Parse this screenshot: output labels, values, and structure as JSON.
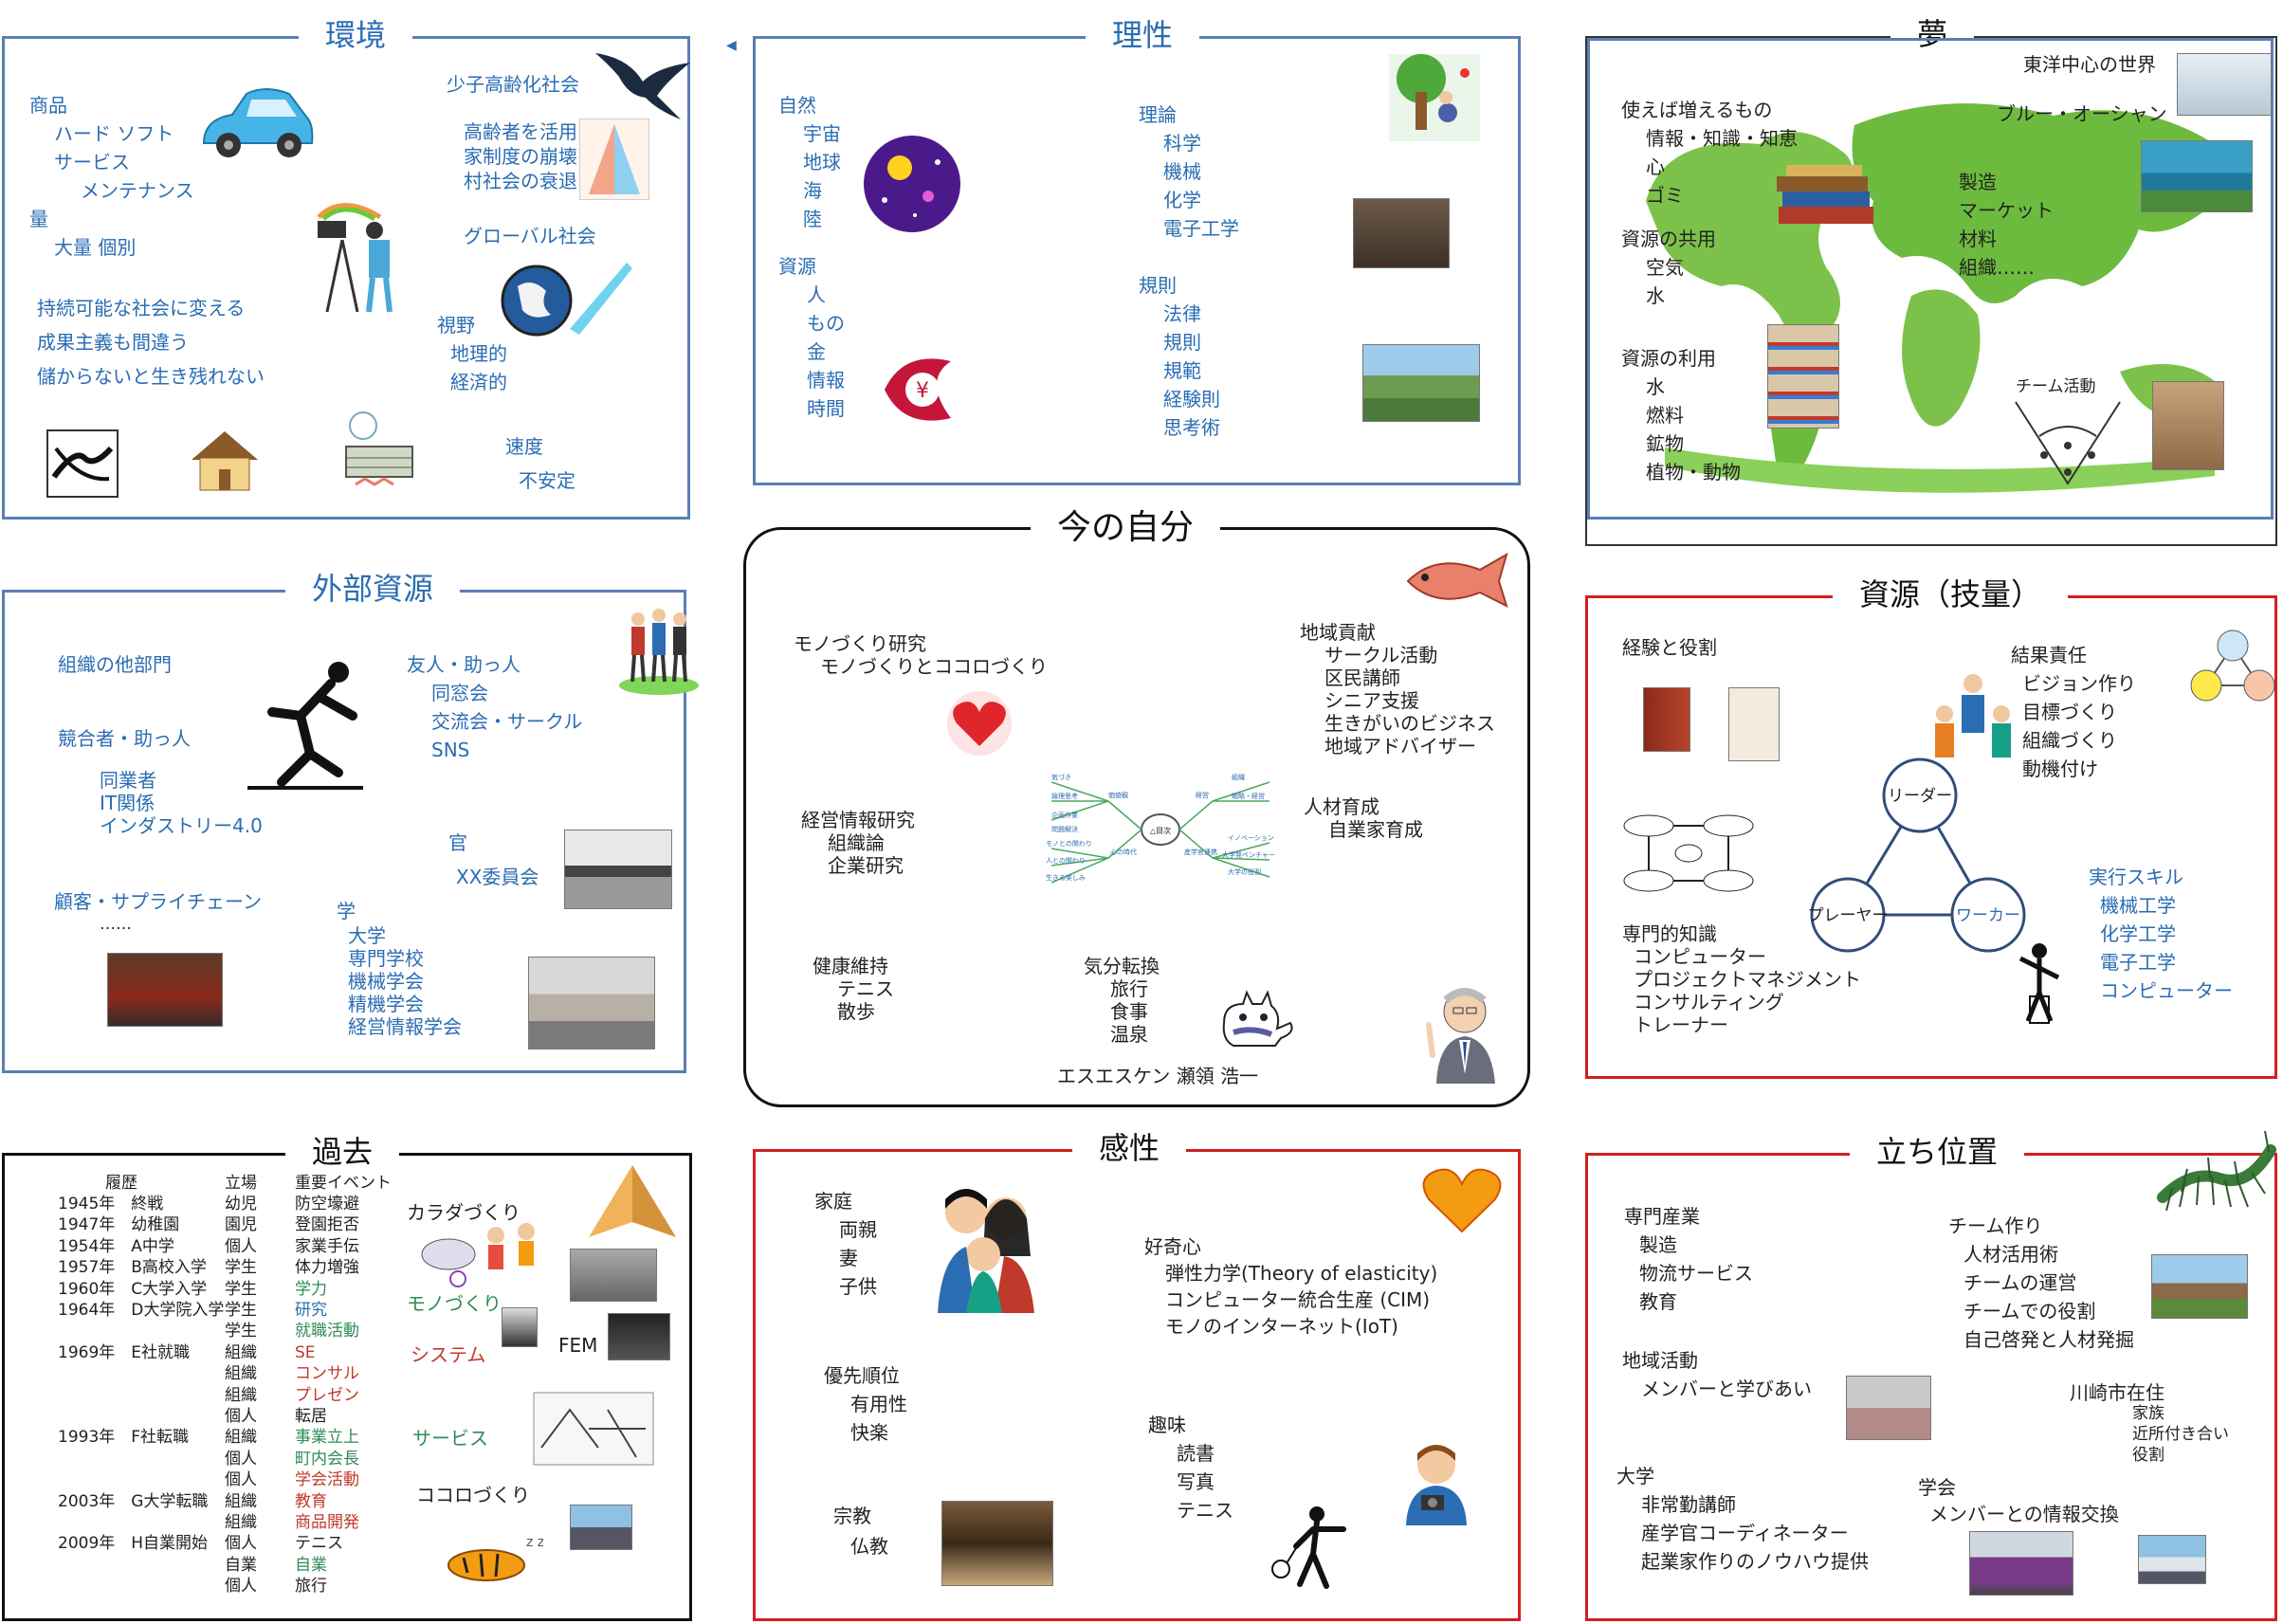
{
  "panels": {
    "env": {
      "title": "環境",
      "lines": [
        "商品",
        "ハード ソフト",
        "サービス",
        "メンテナンス",
        "量",
        "大量 個別",
        "持続可能な社会に変える",
        "成果主義も間違う",
        "儲からないと生き残れない",
        "少子高齢化社会",
        "高齢者を活用",
        "家制度の崩壊",
        "村社会の衰退",
        "グローバル社会",
        "視野",
        "地理的",
        "経済的",
        "速度",
        "不安定"
      ]
    },
    "reason": {
      "title": "理性",
      "lines": [
        "自然",
        "宇宙",
        "地球",
        "海",
        "陸",
        "資源",
        "人",
        "もの",
        "金",
        "情報",
        "時間",
        "理論",
        "科学",
        "機械",
        "化学",
        "電子工学",
        "規則",
        "法律",
        "規則",
        "規範",
        "経験則",
        "思考術"
      ]
    },
    "dream": {
      "title": "夢",
      "lines": [
        "東洋中心の世界",
        "使えば増えるもの",
        "情報・知識・知恵",
        "心",
        "ゴミ",
        "ブルー・オーシャン",
        "製造",
        "マーケット",
        "材料",
        "組織……",
        "資源の共用",
        "空気",
        "水",
        "資源の利用",
        "水",
        "燃料",
        "鉱物",
        "植物・動物",
        "チーム活動"
      ]
    },
    "external": {
      "title": "外部資源",
      "lines": [
        "組織の他部門",
        "友人・助っ人",
        "同窓会",
        "交流会・サークル",
        "SNS",
        "競合者・助っ人",
        "同業者",
        "IT関係",
        "インダストリー4.0",
        "官",
        "XX委員会",
        "顧客・サプライチェーン",
        "……",
        "学",
        "大学",
        "専門学校",
        "機械学会",
        "精機学会",
        "経営情報学会"
      ]
    },
    "self": {
      "title": "今の自分",
      "lines": [
        "モノづくり研究",
        "モノづくりとココロづくり",
        "地域貢献",
        "サークル活動",
        "区民講師",
        "シニア支援",
        "生きがいのビジネス",
        "地域アドバイザー",
        "経営情報研究",
        "組織論",
        "企業研究",
        "人材育成",
        "自業家育成",
        "健康維持",
        "テニス",
        "散歩",
        "気分転換",
        "旅行",
        "食事",
        "温泉",
        "エスエスケン 瀬領 浩一"
      ],
      "mindmap": [
        "△目次",
        "気づき",
        "論理思考",
        "企画作業",
        "問題解決",
        "価値観",
        "モノとの関わり",
        "人との関わり",
        "生きる楽しみ",
        "心の時代",
        "経営",
        "組織",
        "戦略・経営",
        "イノベーション",
        "大学発ベンチャー",
        "大学の役割",
        "産学官連携"
      ]
    },
    "resources": {
      "title": "資源（技量）",
      "lines": [
        "経験と役割",
        "結果責任",
        "ビジョン作り",
        "目標づくり",
        "組織づくり",
        "動機付け",
        "専門的知識",
        "コンピューター",
        "プロジェクトマネジメント",
        "コンサルティング",
        "トレーナー",
        "実行スキル",
        "機械工学",
        "化学工学",
        "電子工学",
        "コンピューター"
      ],
      "triangle": [
        "リーダー",
        "プレーヤー",
        "ワーカー"
      ]
    },
    "past": {
      "title": "過去",
      "headers": [
        "履歴",
        "立場",
        "重要イベント"
      ],
      "rows": [
        [
          "1945年　終戦",
          "幼児",
          "防空壕避"
        ],
        [
          "1947年　幼稚園",
          "園児",
          "登園拒否"
        ],
        [
          "1954年　A中学",
          "個人",
          "家業手伝"
        ],
        [
          "1957年　B高校入学",
          "学生",
          "体力増強"
        ],
        [
          "1960年　C大学入学",
          "学生",
          "学力"
        ],
        [
          "1964年　D大学院入学",
          "学生",
          "研究"
        ],
        [
          "",
          "学生",
          "就職活動"
        ],
        [
          "1969年　E社就職",
          "組織",
          "SE"
        ],
        [
          "",
          "組織",
          "コンサル"
        ],
        [
          "",
          "組織",
          "プレゼン"
        ],
        [
          "",
          "個人",
          "転居"
        ],
        [
          "1993年　F社転職",
          "組織",
          "事業立上"
        ],
        [
          "",
          "個人",
          "町内会長"
        ],
        [
          "",
          "個人",
          "学会活動"
        ],
        [
          "2003年　G大学転職",
          "組織",
          "教育"
        ],
        [
          "",
          "組織",
          "商品開発"
        ],
        [
          "2009年　H自業開始",
          "個人",
          "テニス"
        ],
        [
          "",
          "自業",
          "自業"
        ],
        [
          "",
          "個人",
          "旅行"
        ]
      ],
      "right": [
        "カラダづくり",
        "モノづくり",
        "FEM",
        "システム",
        "サービス",
        "ココロづくり"
      ]
    },
    "kansei": {
      "title": "感性",
      "lines": [
        "家庭",
        "両親",
        "妻",
        "子供",
        "好奇心",
        "弾性力学(Theory of elasticity)",
        "コンピューター統合生産 (CIM)",
        "モノのインターネット(IoT)",
        "優先順位",
        "有用性",
        "快楽",
        "趣味",
        "読書",
        "写真",
        "テニス",
        "宗教",
        "仏教"
      ]
    },
    "position": {
      "title": "立ち位置",
      "lines": [
        "専門産業",
        "製造",
        "物流サービス",
        "教育",
        "チーム作り",
        "人材活用術",
        "チームの運営",
        "チームでの役割",
        "自己啓発と人材発掘",
        "地域活動",
        "メンバーと学びあい",
        "川崎市在住",
        "家族",
        "近所付き合い",
        "役割",
        "大学",
        "非常勤講師",
        "産学官コーディネーター",
        "起業家作りのノウハウ提供",
        "学会",
        "メンバーとの情報交換"
      ]
    }
  },
  "colors": {
    "blue_frame": "#5b7fb5",
    "red_frame": "#d21f1f",
    "blue_text": "#2a6db3",
    "red_text": "#c0392b",
    "green_text": "#2e8b57"
  }
}
